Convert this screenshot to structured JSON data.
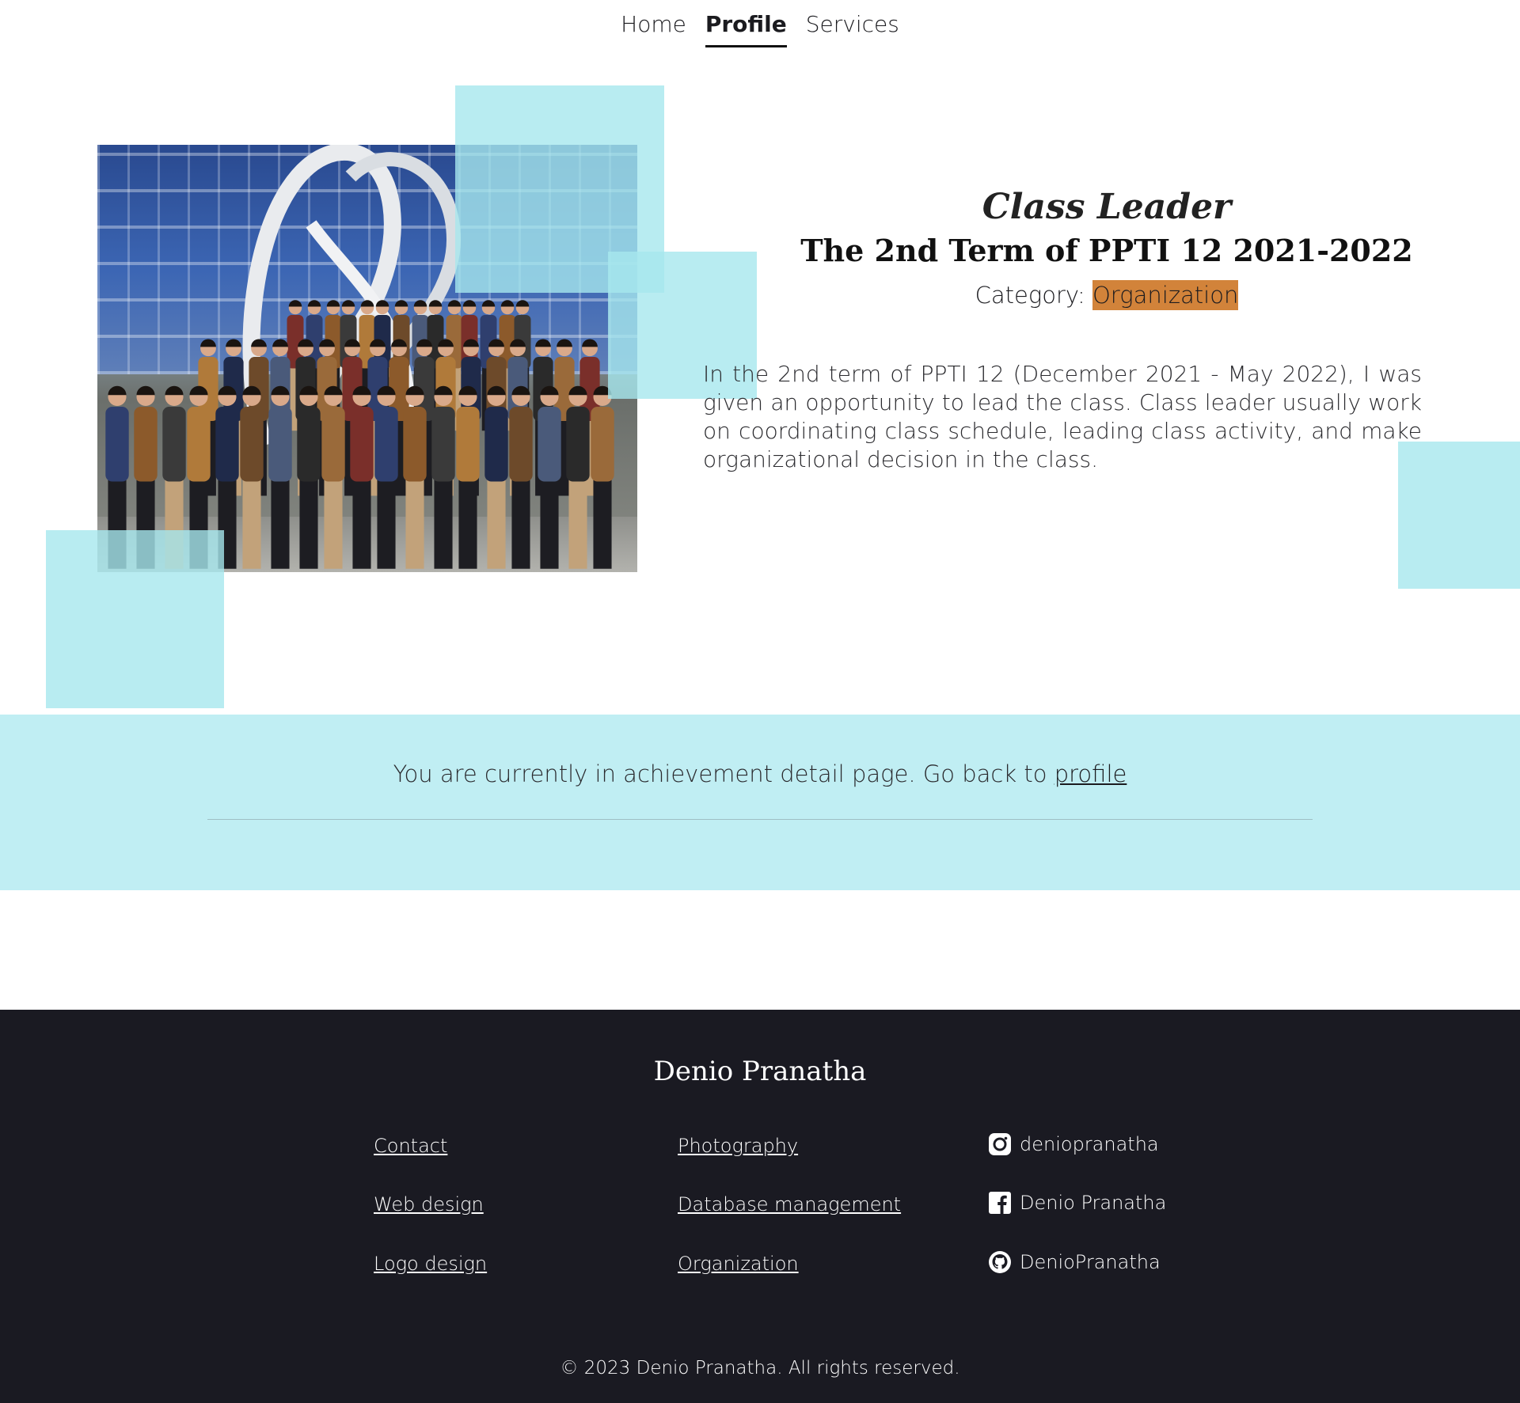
{
  "nav": {
    "items": [
      {
        "label": "Home",
        "active": false
      },
      {
        "label": "Profile",
        "active": true
      },
      {
        "label": "Services",
        "active": false
      }
    ]
  },
  "achievement": {
    "role": "Class Leader",
    "term": "The 2nd Term of PPTI 12 2021-2022",
    "category_label": "Category: ",
    "category_value": "Organization",
    "description": "In the 2nd term of PPTI 12 (December 2021 - May 2022), I was given an opportunity to lead the class. Class leader usually work on coordinating class schedule, leading class activity, and make organizational decision in the class."
  },
  "band": {
    "text": "You are currently in achievement detail page. Go back to ",
    "link": "profile"
  },
  "footer": {
    "name": "Denio Pranatha",
    "col1": [
      "Contact",
      "Web design",
      "Logo design"
    ],
    "col2": [
      "Photography",
      "Database management",
      "Organization"
    ],
    "social": [
      {
        "icon": "instagram-icon",
        "label": "deniopranatha"
      },
      {
        "icon": "facebook-icon",
        "label": "Denio Pranatha"
      },
      {
        "icon": "github-icon",
        "label": "DenioPranatha"
      }
    ],
    "copyright": "© 2023 Denio Pranatha. All rights reserved."
  },
  "colors": {
    "accent_square": "#a6e7ee",
    "band_bg": "#c0eef3",
    "category_badge": "#d2833a",
    "footer_bg": "#1a1a22"
  }
}
